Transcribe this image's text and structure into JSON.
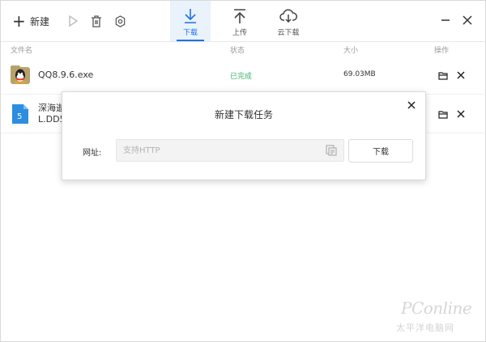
{
  "toolbar": {
    "new_label": "新建",
    "tabs": [
      {
        "label": "下载",
        "icon": "download-icon",
        "active": true
      },
      {
        "label": "上传",
        "icon": "upload-icon",
        "active": false
      },
      {
        "label": "云下载",
        "icon": "cloud-download-icon",
        "active": false
      }
    ]
  },
  "table": {
    "headers": {
      "name": "文件名",
      "status": "状态",
      "size": "大小",
      "actions": "操作"
    },
    "rows": [
      {
        "name_line1": "QQ8.9.6.exe",
        "name_line2": "",
        "status": "已完成",
        "size": "69.03MB",
        "icon": "qq-app-icon"
      },
      {
        "name_line1": "深海逝",
        "name_line2": "L.DD5",
        "status": "",
        "size": "",
        "icon": "doc-file-icon"
      }
    ]
  },
  "dialog": {
    "title": "新建下载任务",
    "url_label": "网址:",
    "url_placeholder": "支持HTTP",
    "url_value": "",
    "download_button": "下载"
  },
  "watermark": {
    "brand": "PConline",
    "sub": "太平洋电脑网"
  },
  "colors": {
    "accent": "#1a73e8",
    "success": "#3cb371"
  }
}
